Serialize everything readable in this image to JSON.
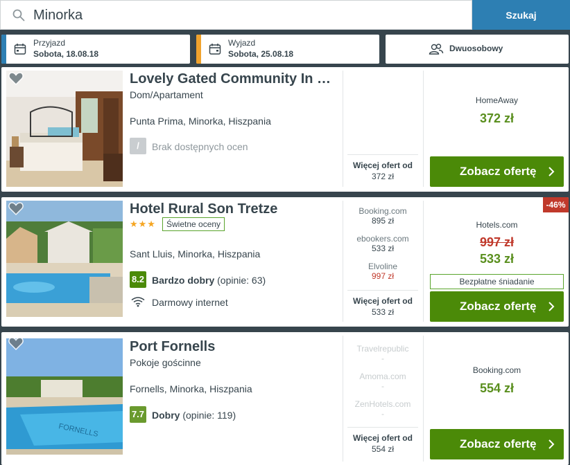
{
  "search": {
    "value": "Minorka",
    "button_label": "Szukaj"
  },
  "filters": {
    "checkin": {
      "label": "Przyjazd",
      "value": "Sobota, 18.08.18",
      "accent": "#2d7fb3"
    },
    "checkout": {
      "label": "Wyjazd",
      "value": "Sobota, 25.08.18",
      "accent": "#f0a22d"
    },
    "room": {
      "label": "Dwuosobowy"
    }
  },
  "hotels": [
    {
      "name": "Lovely Gated Community In …",
      "type": "Dom/Apartament",
      "location": "Punta Prima, Minorka, Hiszpania",
      "rating_symbol": "/",
      "rating_text": "Brak dostępnych ocen",
      "more_offers_label": "Więcej ofert od",
      "more_offers_price": "372 zł",
      "best_site": "HomeAway",
      "best_price": "372 zł",
      "cta": "Zobacz ofertę"
    },
    {
      "name": "Hotel Rural Son Tretze",
      "stars": "★★★",
      "stars_badge": "Świetne oceny",
      "location": "Sant Lluis, Minorka, Hiszpania",
      "score": "8.2",
      "score_color": "#4b8a08",
      "score_label": "Bardzo dobry",
      "score_count": "(opinie: 63)",
      "amenity": "Darmowy internet",
      "offers": [
        {
          "site": "Booking.com",
          "price": "895 zł"
        },
        {
          "site": "ebookers.com",
          "price": "533 zł"
        },
        {
          "site": "Elvoline",
          "price": "997 zł"
        }
      ],
      "more_offers_label": "Więcej ofert od",
      "more_offers_price": "533 zł",
      "discount": "-46%",
      "best_site": "Hotels.com",
      "old_price": "997 zł",
      "best_price": "533 zł",
      "extra_badge": "Bezpłatne śniadanie",
      "cta": "Zobacz ofertę"
    },
    {
      "name": "Port Fornells",
      "type": "Pokoje gościnne",
      "location": "Fornells, Minorka, Hiszpania",
      "score": "7.7",
      "score_color": "#6a9a2e",
      "score_label": "Dobry",
      "score_count": "(opinie: 119)",
      "offers": [
        {
          "site": "Travelrepublic",
          "price": "-"
        },
        {
          "site": "Amoma.com",
          "price": "-"
        },
        {
          "site": "ZenHotels.com",
          "price": "-"
        }
      ],
      "more_offers_label": "Więcej ofert od",
      "more_offers_price": "554 zł",
      "best_site": "Booking.com",
      "best_price": "554 zł",
      "cta": "Zobacz ofertę"
    }
  ]
}
